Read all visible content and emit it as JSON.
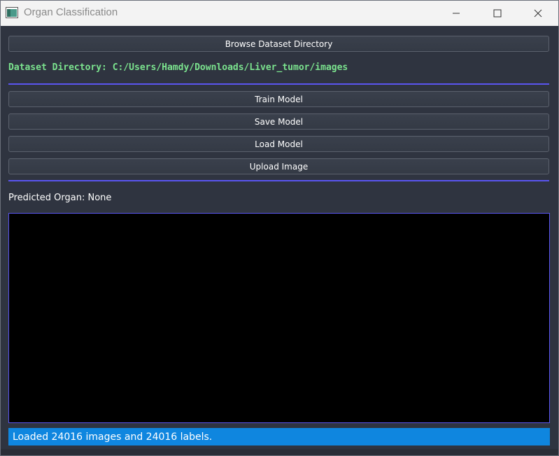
{
  "window": {
    "title": "Organ Classification"
  },
  "toolbar": {
    "browse_label": "Browse Dataset Directory",
    "train_label": "Train Model",
    "save_label": "Save Model",
    "load_label": "Load Model",
    "upload_label": "Upload Image"
  },
  "dataset": {
    "directory_text": "Dataset Directory: C:/Users/Hamdy/Downloads/Liver_tumor/images"
  },
  "prediction": {
    "text": "Predicted Organ: None"
  },
  "status": {
    "message": "Loaded 24016 images and 24016 labels."
  },
  "colors": {
    "background": "#2f3440",
    "accent_separator": "#5a55f0",
    "dataset_text": "#7be38e",
    "status_bar": "#0f86df",
    "image_area": "#000000"
  },
  "icons": {
    "app": "app-window-icon",
    "minimize": "minimize-icon",
    "maximize": "maximize-icon",
    "close": "close-icon"
  }
}
